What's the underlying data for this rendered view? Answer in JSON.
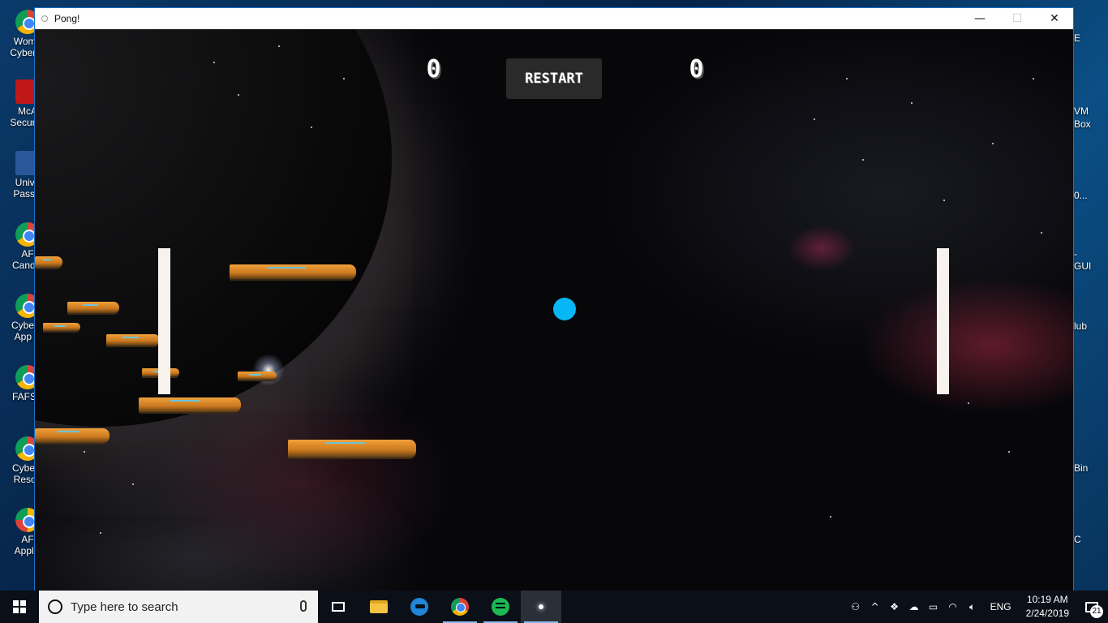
{
  "window": {
    "title": "Pong!",
    "controls": {
      "minimize": "—",
      "maximize": "☐",
      "close": "✕"
    }
  },
  "game": {
    "left_score": "0",
    "right_score": "0",
    "restart_label": "RESTART",
    "ball_color": "#06b6f5",
    "paddle_color": "#f7f2ee"
  },
  "desktop": {
    "left_icons": [
      {
        "label": "Wome\nCyber S",
        "icon": "chrome-icon"
      },
      {
        "label": "McA\nSecurity",
        "icon": "mcafee-icon"
      },
      {
        "label": "Unive\nPassw",
        "icon": "word-icon"
      },
      {
        "label": "AF\nCandid",
        "icon": "chrome-icon"
      },
      {
        "label": "CyberP\nApp S",
        "icon": "chrome-icon"
      },
      {
        "label": "FAFSA",
        "icon": "chrome-icon"
      },
      {
        "label": "Cybers\nResou",
        "icon": "chrome-icon"
      },
      {
        "label": "AF\nApplic",
        "icon": "chrome-icon"
      }
    ],
    "right_labels": [
      "E",
      "VM",
      "Box",
      "0...",
      "-",
      "GUI",
      "lub",
      "Bin",
      "C"
    ]
  },
  "taskbar": {
    "search_placeholder": "Type here to search",
    "apps": [
      "task-view",
      "file-explorer",
      "edge",
      "chrome",
      "spotify",
      "pong"
    ],
    "language": "ENG",
    "time": "10:19 AM",
    "date": "2/24/2019",
    "notification_count": "21"
  }
}
